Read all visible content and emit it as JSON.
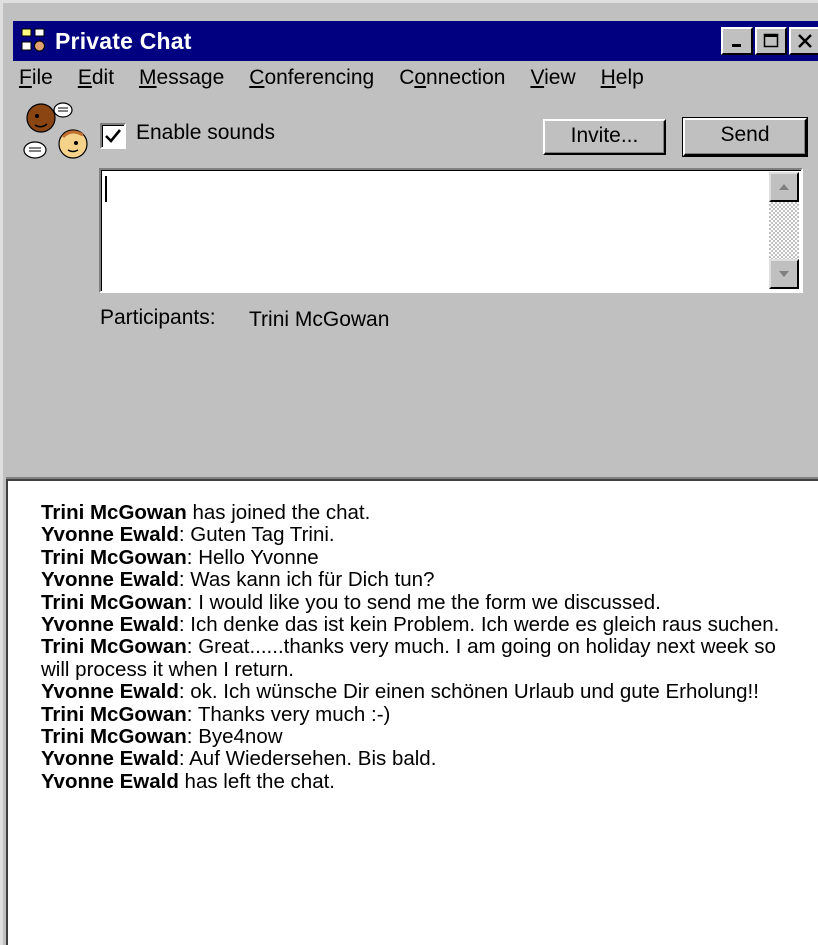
{
  "window": {
    "title": "Private Chat",
    "controls": [
      "minimize",
      "maximize",
      "close"
    ]
  },
  "menu": [
    {
      "label": "File"
    },
    {
      "label": "Edit"
    },
    {
      "label": "Message"
    },
    {
      "label": "Conferencing"
    },
    {
      "label": "Connection"
    },
    {
      "label": "View"
    },
    {
      "label": "Help"
    }
  ],
  "toolbar": {
    "enable_sounds_label": "Enable sounds",
    "enable_sounds_checked": true,
    "invite_label": "Invite...",
    "send_label": "Send"
  },
  "compose": {
    "value": ""
  },
  "participants": {
    "label": "Participants:",
    "names": "Trini McGowan"
  },
  "transcript": [
    {
      "author": "Trini McGowan",
      "sep": "",
      "text": " has joined the chat."
    },
    {
      "author": "Yvonne Ewald",
      "sep": ":",
      "text": " Guten Tag Trini."
    },
    {
      "author": "Trini McGowan",
      "sep": ":",
      "text": " Hello Yvonne"
    },
    {
      "author": "Yvonne Ewald",
      "sep": ":",
      "text": " Was kann ich für Dich tun?"
    },
    {
      "author": "Trini McGowan",
      "sep": ":",
      "text": " I would like you to send me the form we discussed."
    },
    {
      "author": "Yvonne Ewald",
      "sep": ":",
      "text": " Ich denke das ist kein Problem. Ich werde es gleich raus suchen."
    },
    {
      "author": "Trini McGowan",
      "sep": ":",
      "text": " Great......thanks very much.  I am going on holiday next week so will process it when I return."
    },
    {
      "author": "Yvonne Ewald",
      "sep": ":",
      "text": " ok. Ich wünsche Dir einen schönen Urlaub und gute Erholung!!"
    },
    {
      "author": "Trini McGowan",
      "sep": ":",
      "text": " Thanks very much :-)"
    },
    {
      "author": "Trini McGowan",
      "sep": ":",
      "text": " Bye4now"
    },
    {
      "author": "Yvonne Ewald",
      "sep": ":",
      "text": " Auf Wiedersehen. Bis bald."
    },
    {
      "author": "Yvonne Ewald",
      "sep": "",
      "text": " has left the chat."
    }
  ]
}
